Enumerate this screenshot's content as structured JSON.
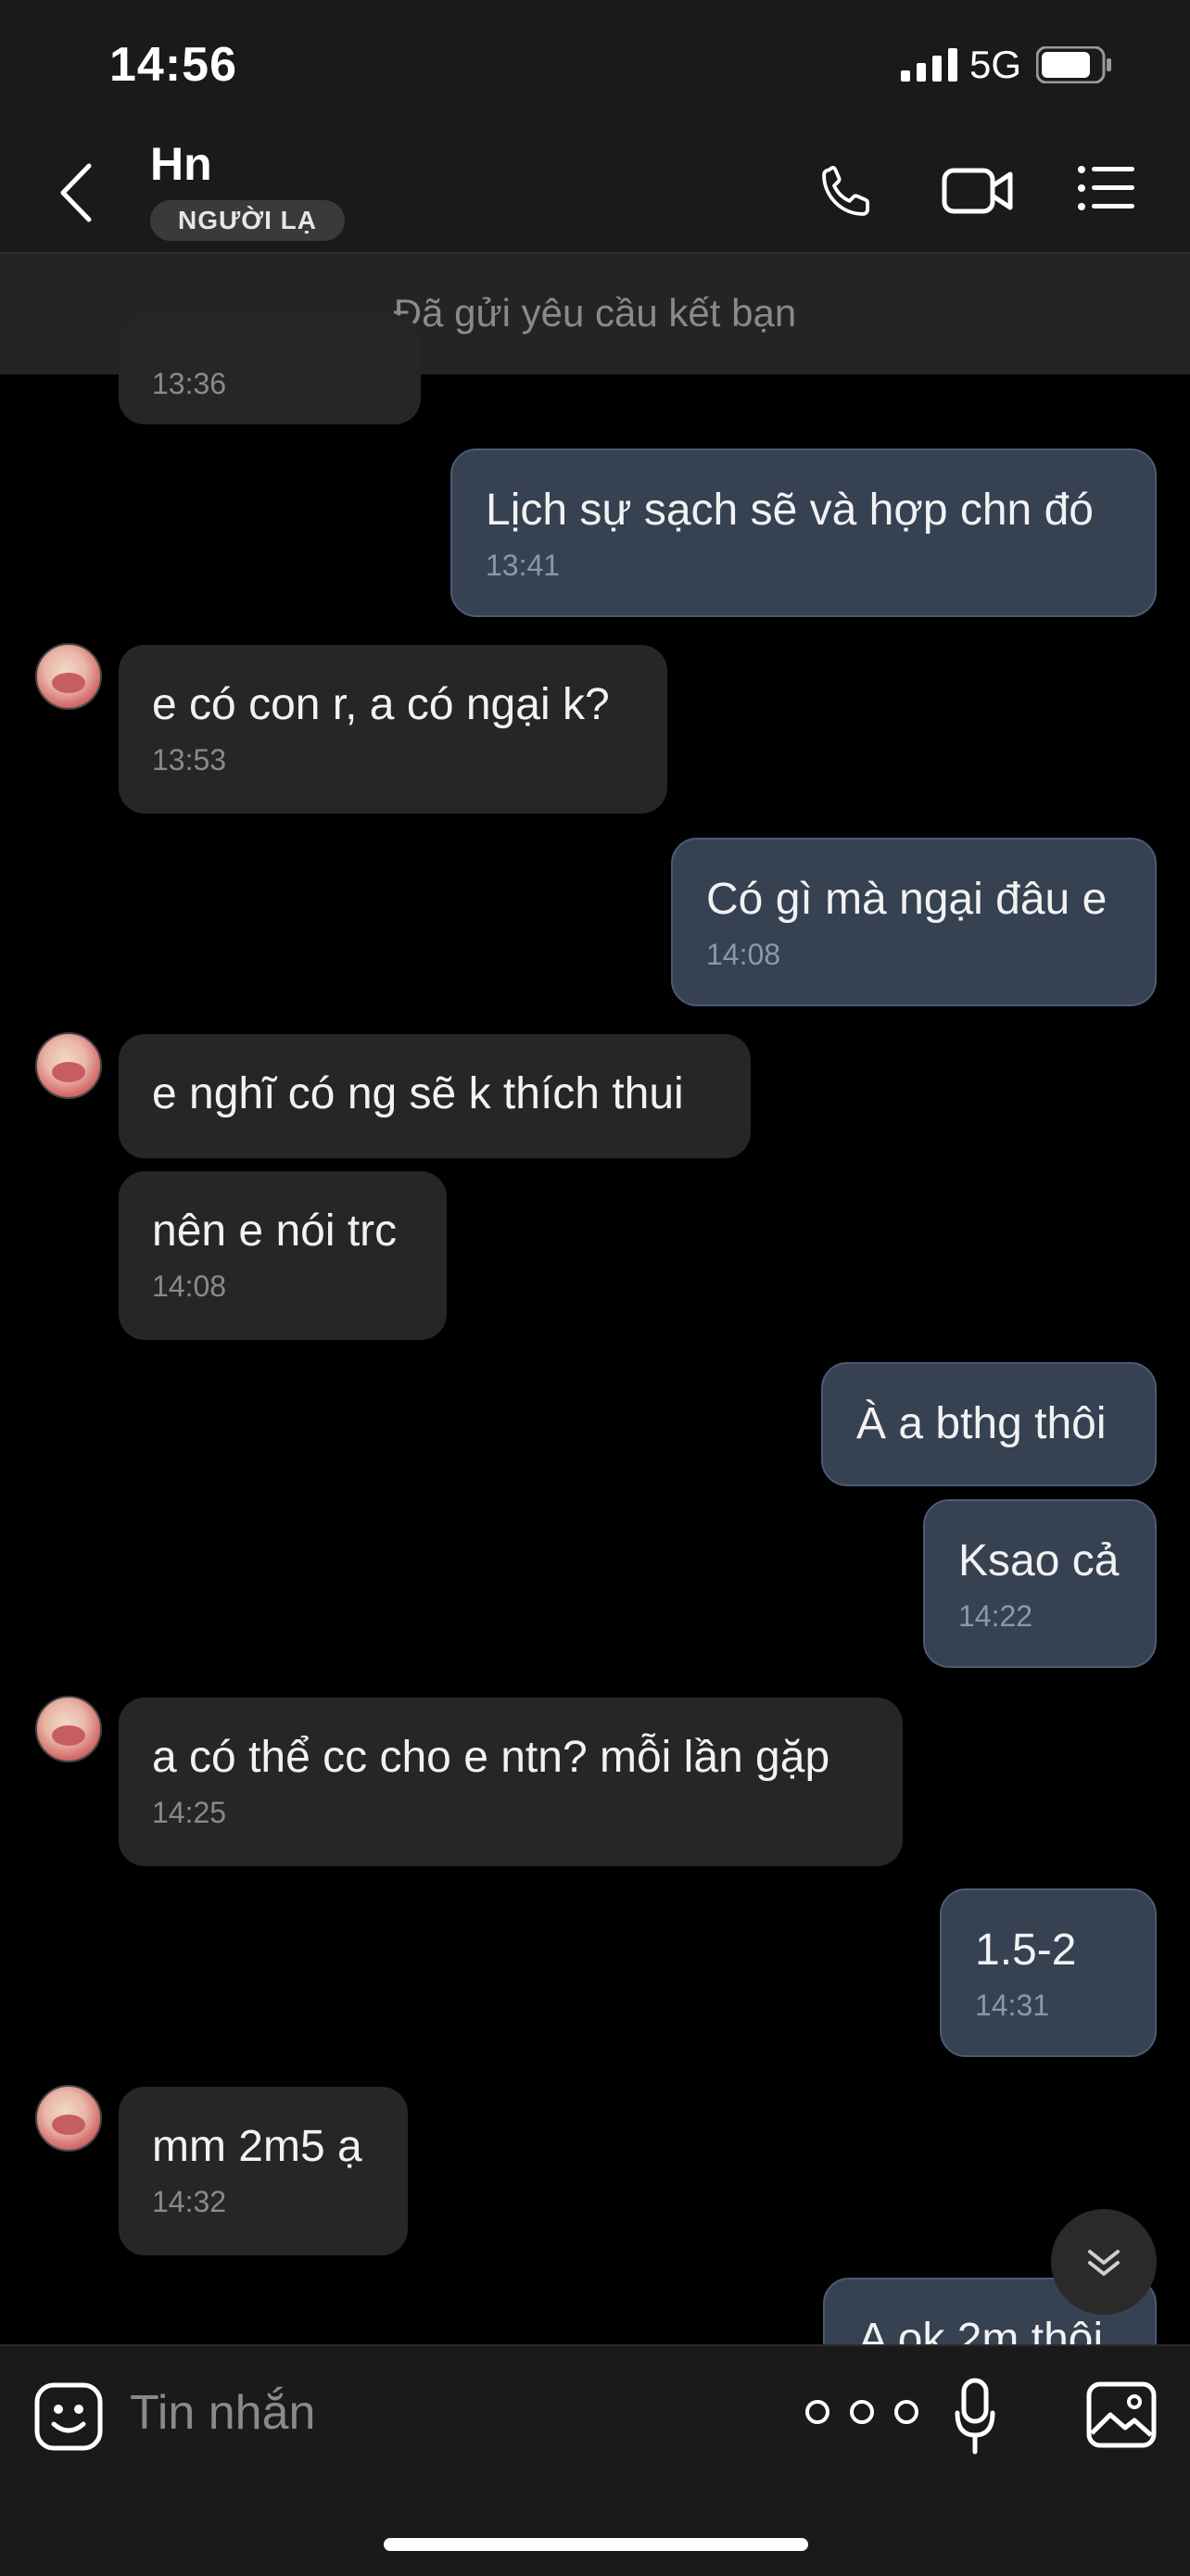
{
  "status_bar": {
    "time": "14:56",
    "network": "5G"
  },
  "header": {
    "contact_name": "Hn",
    "badge": "NGƯỜI LẠ"
  },
  "banner": {
    "text": "Đã gửi yêu cầu kết bạn"
  },
  "messages": [
    {
      "dir": "in",
      "text": "",
      "time": "13:36"
    },
    {
      "dir": "out",
      "text": "Lịch sự sạch sẽ và hợp chn đó",
      "time": "13:41"
    },
    {
      "dir": "in",
      "text": "e có con r, a có ngại k?",
      "time": "13:53"
    },
    {
      "dir": "out",
      "text": "Có gì mà ngại đâu e",
      "time": "14:08"
    },
    {
      "dir": "in",
      "text": "e nghĩ có ng sẽ k thích thui",
      "time": ""
    },
    {
      "dir": "in",
      "text": "nên e nói trc",
      "time": "14:08"
    },
    {
      "dir": "out",
      "text": "À a bthg thôi",
      "time": ""
    },
    {
      "dir": "out",
      "text": "Ksao cả",
      "time": "14:22"
    },
    {
      "dir": "in",
      "text": "a có thể cc cho e ntn? mỗi lần gặp",
      "time": "14:25"
    },
    {
      "dir": "out",
      "text": "1.5-2",
      "time": "14:31"
    },
    {
      "dir": "in",
      "text": "mm 2m5 ạ",
      "time": "14:32"
    },
    {
      "dir": "out",
      "text": "A ok 2m thôi",
      "time": ""
    }
  ],
  "input": {
    "placeholder": "Tin nhắn"
  },
  "icons": {
    "back": "chevron-left-icon",
    "call": "phone-icon",
    "video": "video-camera-icon",
    "menu": "list-menu-icon",
    "emoji": "sticker-face-icon",
    "more": "more-dots-icon",
    "mic": "microphone-icon",
    "image": "image-gallery-icon",
    "scroll": "double-chevron-down-icon"
  },
  "colors": {
    "outgoing_bubble": "#364152",
    "incoming_bubble": "#262626",
    "background": "#000000"
  }
}
